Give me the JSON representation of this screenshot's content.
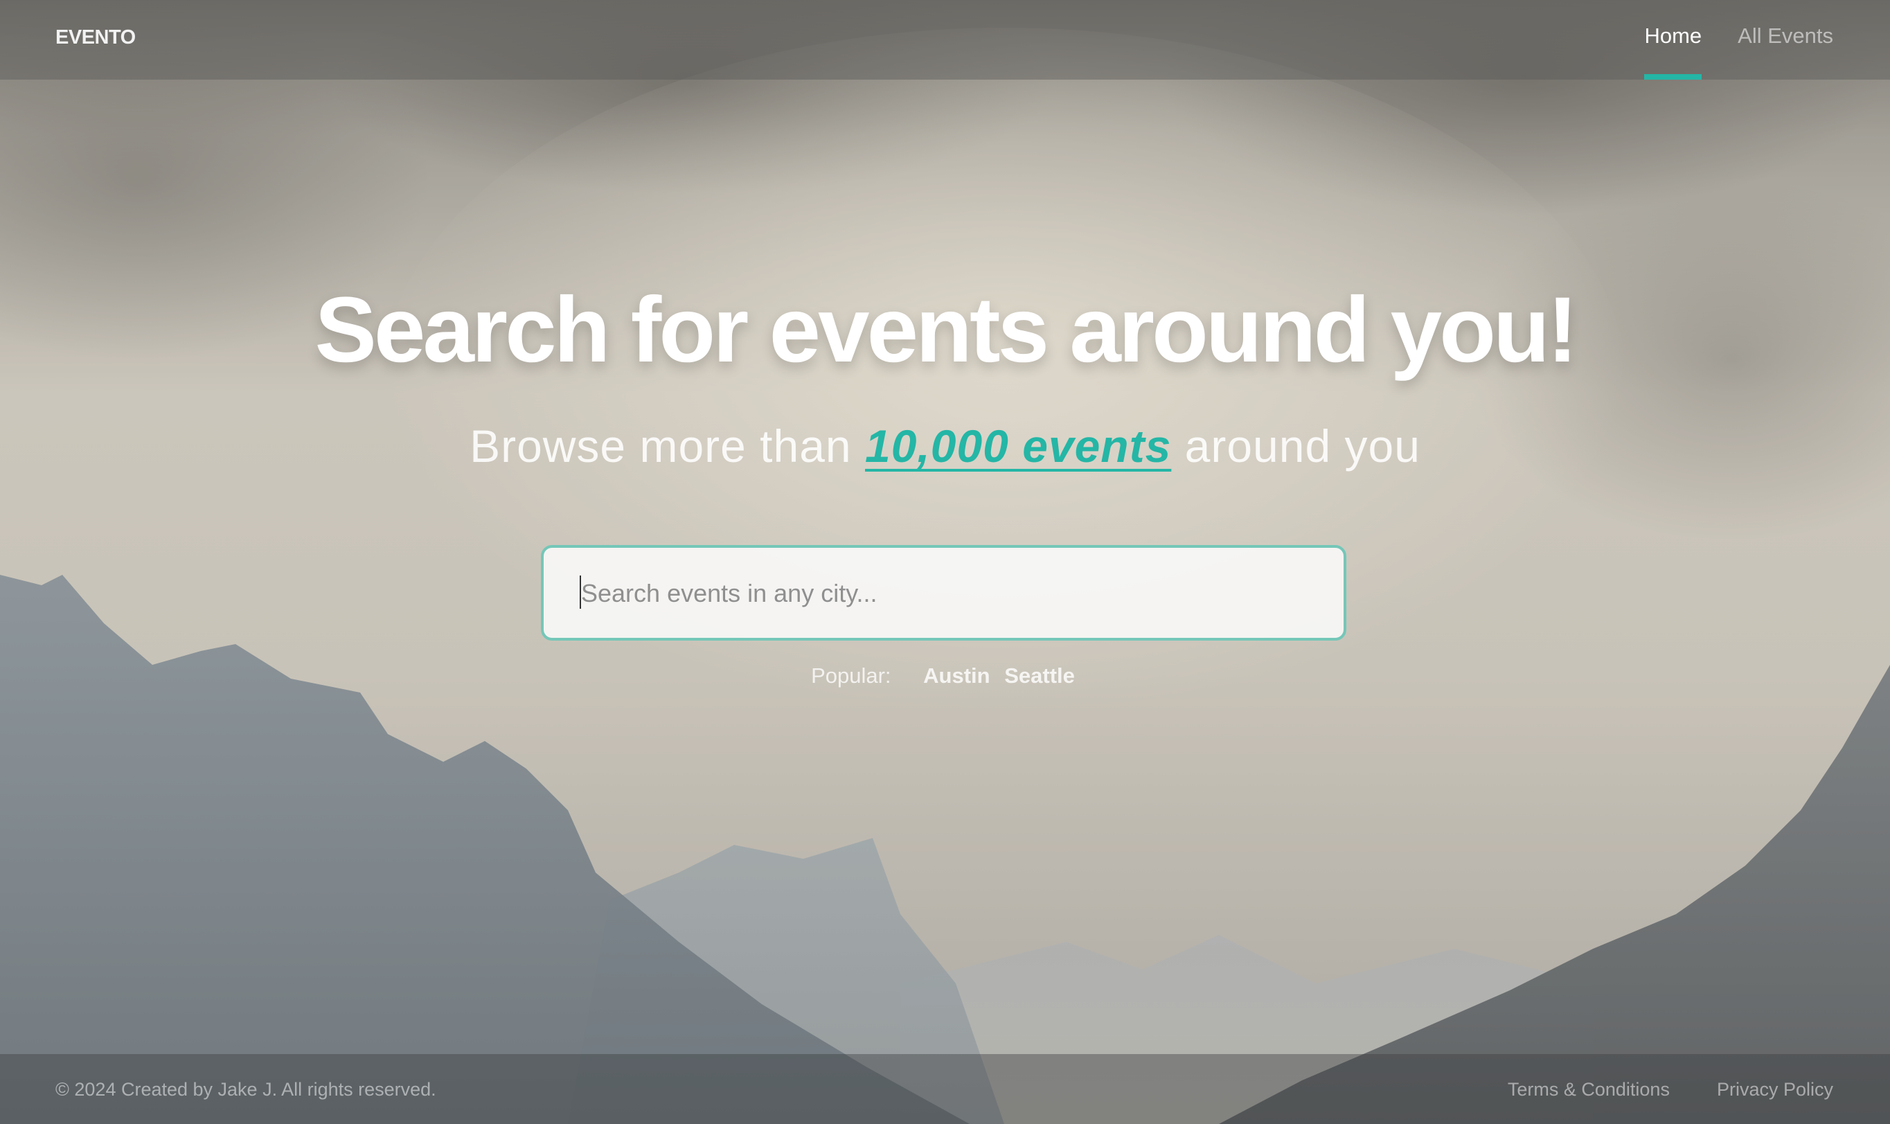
{
  "colors": {
    "accent": "#24b6a6",
    "search_border": "#74c7b8"
  },
  "background": {
    "description_icon": "mountain-landscape-image"
  },
  "header": {
    "logo": "EVENTO",
    "nav": [
      {
        "label": "Home",
        "active": true
      },
      {
        "label": "All Events",
        "active": false
      }
    ]
  },
  "hero": {
    "title": "Search for events around you!",
    "subtitle_prefix": "Browse more than ",
    "subtitle_highlight": "10,000 events",
    "subtitle_suffix": " around you"
  },
  "search": {
    "placeholder": "Search events in any city...",
    "value": ""
  },
  "popular": {
    "label": "Popular:",
    "cities": [
      "Austin",
      "Seattle"
    ]
  },
  "footer": {
    "copyright": "© 2024 Created by Jake J. All rights reserved.",
    "links": [
      "Terms & Conditions",
      "Privacy Policy"
    ]
  }
}
